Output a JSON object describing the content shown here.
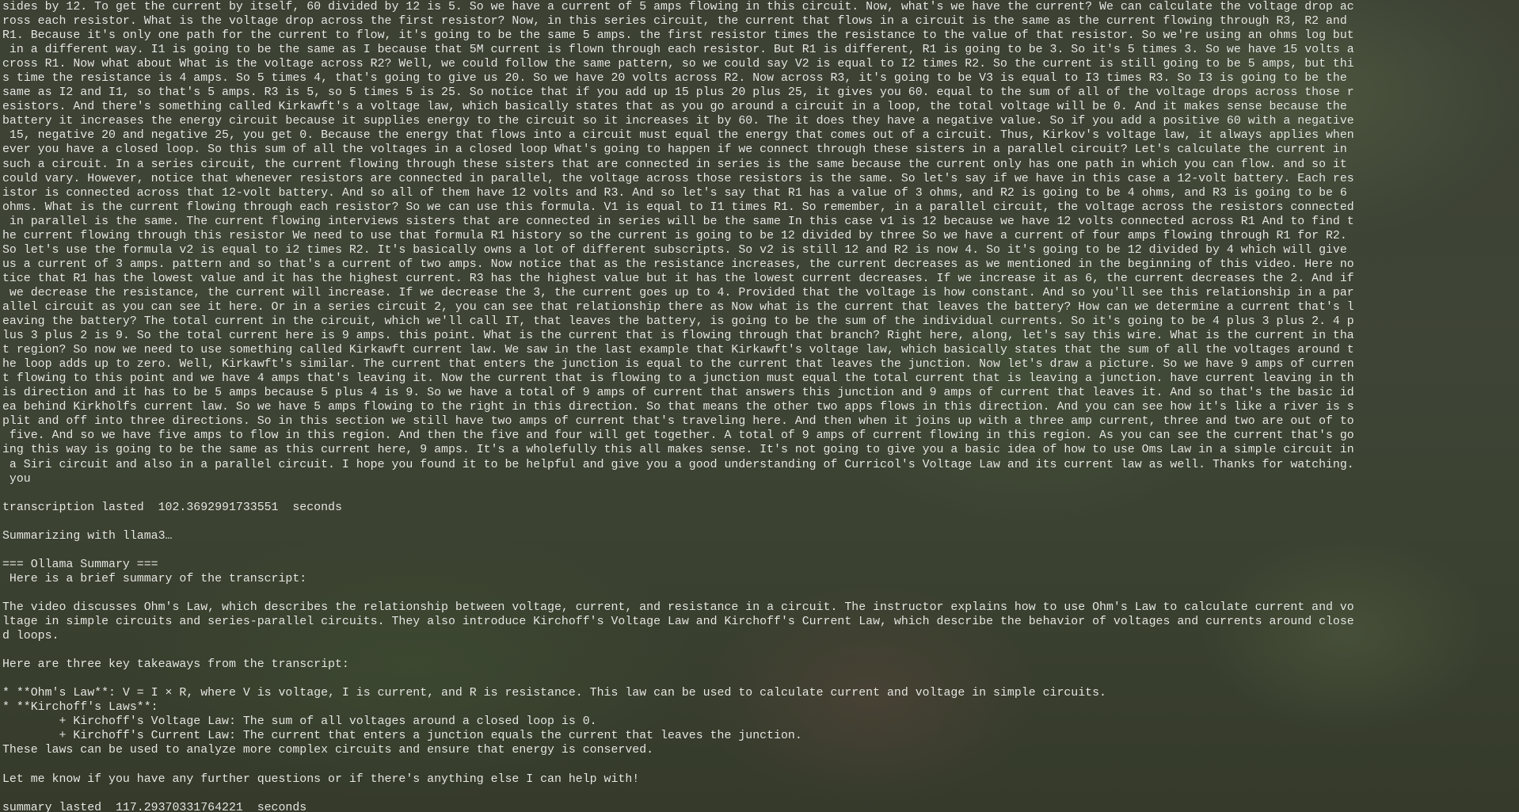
{
  "terminal": {
    "lines": [
      "sides by 12. To get the current by itself, 60 divided by 12 is 5. So we have a current of 5 amps flowing in this circuit. Now, what's we have the current? We can calculate the voltage drop ac",
      "ross each resistor. What is the voltage drop across the first resistor? Now, in this series circuit, the current that flows in a circuit is the same as the current flowing through R3, R2 and",
      "R1. Because it's only one path for the current to flow, it's going to be the same 5 amps. the first resistor times the resistance to the value of that resistor. So we're using an ohms log but",
      " in a different way. I1 is going to be the same as I because that 5M current is flown through each resistor. But R1 is different, R1 is going to be 3. So it's 5 times 3. So we have 15 volts a",
      "cross R1. Now what about What is the voltage across R2? Well, we could follow the same pattern, so we could say V2 is equal to I2 times R2. So the current is still going to be 5 amps, but thi",
      "s time the resistance is 4 amps. So 5 times 4, that's going to give us 20. So we have 20 volts across R2. Now across R3, it's going to be V3 is equal to I3 times R3. So I3 is going to be the",
      "same as I2 and I1, so that's 5 amps. R3 is 5, so 5 times 5 is 25. So notice that if you add up 15 plus 20 plus 25, it gives you 60. equal to the sum of all of the voltage drops across those r",
      "esistors. And there's something called Kirkawft's a voltage law, which basically states that as you go around a circuit in a loop, the total voltage will be 0. And it makes sense because the",
      "battery it increases the energy circuit because it supplies energy to the circuit so it increases it by 60. The it does they have a negative value. So if you add a positive 60 with a negative",
      " 15, negative 20 and negative 25, you get 0. Because the energy that flows into a circuit must equal the energy that comes out of a circuit. Thus, Kirkov's voltage law, it always applies when",
      "ever you have a closed loop. So this sum of all the voltages in a closed loop What's going to happen if we connect through these sisters in a parallel circuit? Let's calculate the current in",
      "such a circuit. In a series circuit, the current flowing through these sisters that are connected in series is the same because the current only has one path in which you can flow. and so it",
      "could vary. However, notice that whenever resistors are connected in parallel, the voltage across those resistors is the same. So let's say if we have in this case a 12-volt battery. Each res",
      "istor is connected across that 12-volt battery. And so all of them have 12 volts and R3. And so let's say that R1 has a value of 3 ohms, and R2 is going to be 4 ohms, and R3 is going to be 6",
      "ohms. What is the current flowing through each resistor? So we can use this formula. V1 is equal to I1 times R1. So remember, in a parallel circuit, the voltage across the resistors connected",
      " in parallel is the same. The current flowing interviews sisters that are connected in series will be the same In this case v1 is 12 because we have 12 volts connected across R1 And to find t",
      "he current flowing through this resistor We need to use that formula R1 history so the current is going to be 12 divided by three So we have a current of four amps flowing through R1 for R2.",
      "So let's use the formula v2 is equal to i2 times R2. It's basically owns a lot of different subscripts. So v2 is still 12 and R2 is now 4. So it's going to be 12 divided by 4 which will give",
      "us a current of 3 amps. pattern and so that's a current of two amps. Now notice that as the resistance increases, the current decreases as we mentioned in the beginning of this video. Here no",
      "tice that R1 has the lowest value and it has the highest current. R3 has the highest value but it has the lowest current decreases. If we increase it as 6, the current decreases the 2. And if",
      " we decrease the resistance, the current will increase. If we decrease the 3, the current goes up to 4. Provided that the voltage is how constant. And so you'll see this relationship in a par",
      "allel circuit as you can see it here. Or in a series circuit 2, you can see that relationship there as Now what is the current that leaves the battery? How can we determine a current that's l",
      "eaving the battery? The total current in the circuit, which we'll call IT, that leaves the battery, is going to be the sum of the individual currents. So it's going to be 4 plus 3 plus 2. 4 p",
      "lus 3 plus 2 is 9. So the total current here is 9 amps. this point. What is the current that is flowing through that branch? Right here, along, let's say this wire. What is the current in tha",
      "t region? So now we need to use something called Kirkawft current law. We saw in the last example that Kirkawft's voltage law, which basically states that the sum of all the voltages around t",
      "he loop adds up to zero. Well, Kirkawft's similar. The current that enters the junction is equal to the current that leaves the junction. Now let's draw a picture. So we have 9 amps of curren",
      "t flowing to this point and we have 4 amps that's leaving it. Now the current that is flowing to a junction must equal the total current that is leaving a junction. have current leaving in th",
      "is direction and it has to be 5 amps because 5 plus 4 is 9. So we have a total of 9 amps of current that answers this junction and 9 amps of current that leaves it. And so that's the basic id",
      "ea behind Kirkholfs current law. So we have 5 amps flowing to the right in this direction. So that means the other two apps flows in this direction. And you can see how it's like a river is s",
      "plit and off into three directions. So in this section we still have two amps of current that's traveling here. And then when it joins up with a three amp current, three and two are out of to",
      " five. And so we have five amps to flow in this region. And then the five and four will get together. A total of 9 amps of current flowing in this region. As you can see the current that's go",
      "ing this way is going to be the same as this current here, 9 amps. It's a wholefully this all makes sense. It's not going to give you a basic idea of how to use Oms Law in a simple circuit in",
      " a Siri circuit and also in a parallel circuit. I hope you found it to be helpful and give you a good understanding of Curricol's Voltage Law and its current law as well. Thanks for watching.",
      " you",
      "",
      "transcription lasted  102.3692991733551  seconds",
      "",
      "Summarizing with llama3…",
      "",
      "=== Ollama Summary ===",
      " Here is a brief summary of the transcript:",
      "",
      "The video discusses Ohm's Law, which describes the relationship between voltage, current, and resistance in a circuit. The instructor explains how to use Ohm's Law to calculate current and vo",
      "ltage in simple circuits and series-parallel circuits. They also introduce Kirchoff's Voltage Law and Kirchoff's Current Law, which describe the behavior of voltages and currents around close",
      "d loops.",
      "",
      "Here are three key takeaways from the transcript:",
      "",
      "* **Ohm's Law**: V = I × R, where V is voltage, I is current, and R is resistance. This law can be used to calculate current and voltage in simple circuits.",
      "* **Kirchoff's Laws**:",
      "        + Kirchoff's Voltage Law: The sum of all voltages around a closed loop is 0.",
      "        + Kirchoff's Current Law: The current that enters a junction equals the current that leaves the junction.",
      "These laws can be used to analyze more complex circuits and ensure that energy is conserved.",
      "",
      "Let me know if you have any further questions or if there's anything else I can help with!",
      "",
      "summary lasted  117.29370331764221  seconds"
    ]
  }
}
